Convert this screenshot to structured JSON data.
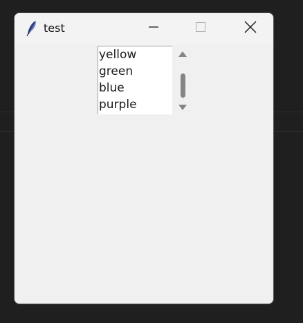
{
  "window": {
    "title": "test",
    "icon": "feather-icon",
    "controls": {
      "minimize": "minimize-icon",
      "maximize": "maximize-icon",
      "close": "close-icon"
    }
  },
  "listbox": {
    "items": [
      "yellow",
      "green",
      "blue",
      "purple"
    ]
  },
  "scrollbar": {
    "up_icon": "triangle-up-icon",
    "down_icon": "triangle-down-icon"
  }
}
